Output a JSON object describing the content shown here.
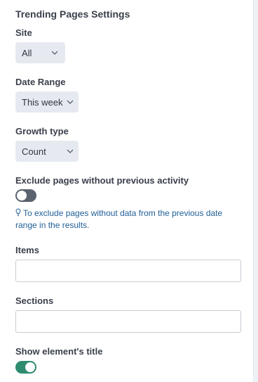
{
  "panel": {
    "title": "Trending Pages Settings"
  },
  "site": {
    "label": "Site",
    "value": "All"
  },
  "date_range": {
    "label": "Date Range",
    "value": "This week"
  },
  "growth_type": {
    "label": "Growth type",
    "value": "Count"
  },
  "exclude_pages": {
    "label": "Exclude pages without previous activity",
    "enabled": false,
    "hint": "To exclude pages without data from the previous date range in the results."
  },
  "items": {
    "label": "Items",
    "value": ""
  },
  "sections": {
    "label": "Sections",
    "value": ""
  },
  "show_title": {
    "label": "Show element's title",
    "enabled": true
  },
  "colors": {
    "toggle_on": "#2e8b6f",
    "toggle_off": "#5b6270",
    "hint_text": "#1f5f97",
    "select_bg": "#e6eaf0"
  },
  "icons": {
    "dropdown": "chevron-down-icon",
    "hint": "lightbulb-icon"
  }
}
